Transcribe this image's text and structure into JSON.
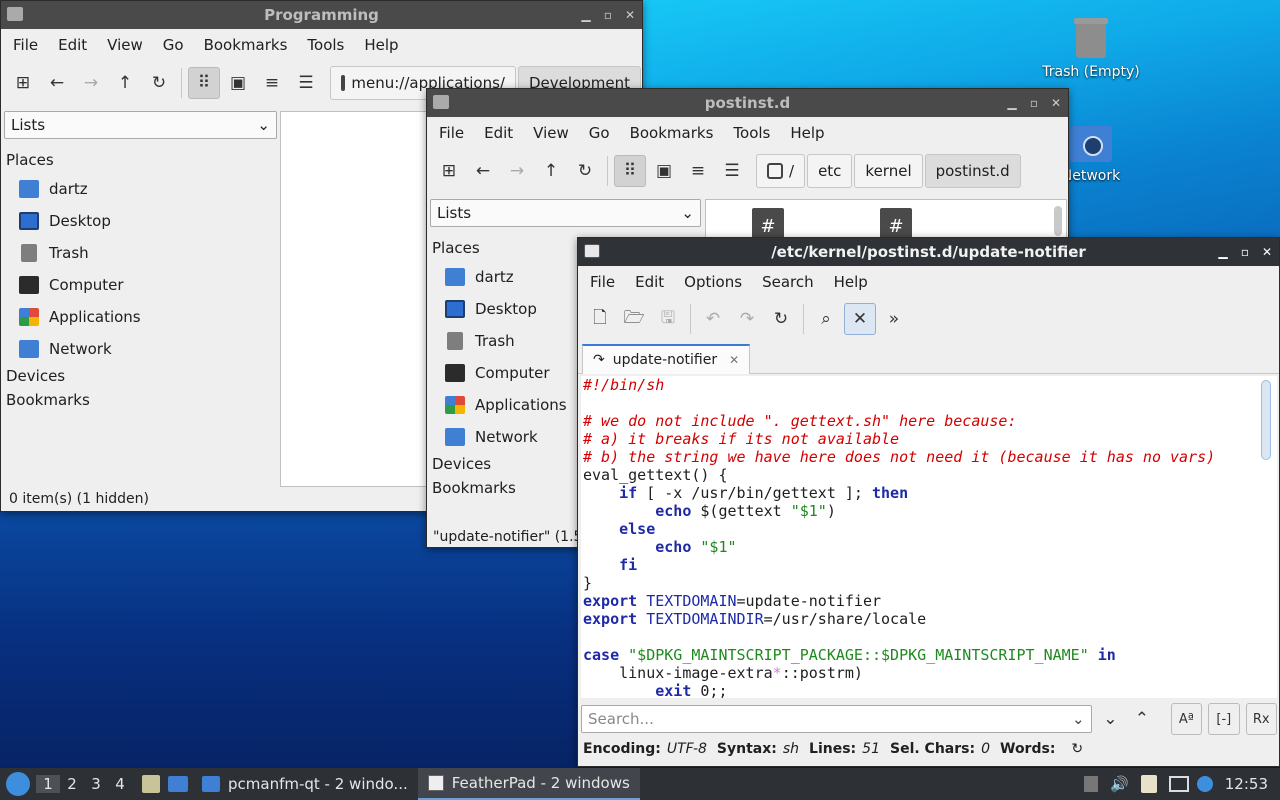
{
  "desktop": {
    "icons": [
      {
        "label": "Trash (Empty)",
        "icon": "trash-icon"
      },
      {
        "label": "Network",
        "icon": "network-icon"
      }
    ]
  },
  "win_programming": {
    "title": "Programming",
    "menu": [
      "File",
      "Edit",
      "View",
      "Go",
      "Bookmarks",
      "Tools",
      "Help"
    ],
    "location": "menu://applications/",
    "path_button": "Development",
    "view_combo": "Lists",
    "sidebar": {
      "places_header": "Places",
      "items": [
        "dartz",
        "Desktop",
        "Trash",
        "Computer",
        "Applications",
        "Network"
      ],
      "devices_header": "Devices",
      "bookmarks_header": "Bookmarks"
    },
    "status": "0 item(s) (1 hidden)"
  },
  "win_postinst": {
    "title": "postinst.d",
    "menu": [
      "File",
      "Edit",
      "View",
      "Go",
      "Bookmarks",
      "Tools",
      "Help"
    ],
    "path": [
      "/",
      "etc",
      "kernel",
      "postinst.d"
    ],
    "view_combo": "Lists",
    "sidebar": {
      "places_header": "Places",
      "items": [
        "dartz",
        "Desktop",
        "Trash",
        "Computer",
        "Applications",
        "Network"
      ],
      "devices_header": "Devices",
      "bookmarks_header": "Bookmarks"
    },
    "status": "\"update-notifier\" (1.5"
  },
  "win_editor": {
    "title": "/etc/kernel/postinst.d/update-notifier",
    "menu": [
      "File",
      "Edit",
      "Options",
      "Search",
      "Help"
    ],
    "tab_label": "update-notifier",
    "search_placeholder": "Search...",
    "status": {
      "encoding_label": "Encoding:",
      "encoding": "UTF-8",
      "syntax_label": "Syntax:",
      "syntax": "sh",
      "lines_label": "Lines:",
      "lines": "51",
      "sel_label": "Sel. Chars:",
      "sel": "0",
      "words_label": "Words:"
    },
    "code": [
      "#!/bin/sh",
      "",
      "# we do not include \". gettext.sh\" here because:",
      "# a) it breaks if its not available",
      "# b) the string we have here does not need it (because it has no vars)",
      "eval_gettext() {",
      "    if [ -x /usr/bin/gettext ]; then",
      "        echo $(gettext \"$1\")",
      "    else",
      "        echo \"$1\"",
      "    fi",
      "}",
      "export TEXTDOMAIN=update-notifier",
      "export TEXTDOMAINDIR=/usr/share/locale",
      "",
      "case \"$DPKG_MAINTSCRIPT_PACKAGE::$DPKG_MAINTSCRIPT_NAME\" in",
      "    linux-image-extra*::postrm)",
      "        exit 0;;"
    ]
  },
  "taskbar": {
    "workspaces": [
      "1",
      "2",
      "3",
      "4"
    ],
    "tasks": [
      "pcmanfm-qt - 2 windo...",
      "FeatherPad - 2 windows"
    ],
    "clock": "12:53"
  }
}
